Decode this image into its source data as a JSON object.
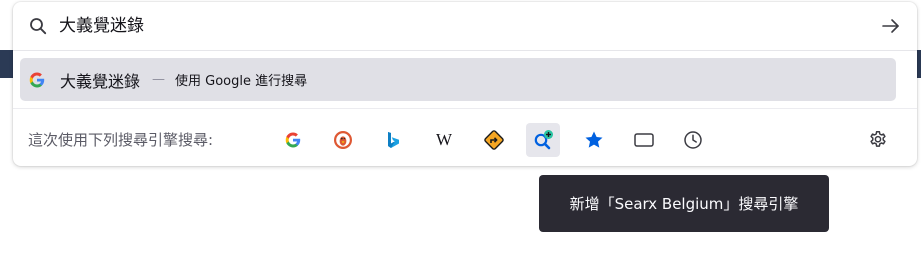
{
  "urlbar": {
    "value": "大義覺迷錄",
    "search_icon": "search-icon",
    "go_icon": "arrow-right-icon"
  },
  "result": {
    "engine_icon": "google-icon",
    "query": "大義覺迷錄",
    "separator": "—",
    "action": "使用 Google 進行搜尋"
  },
  "one_off": {
    "label": "這次使用下列搜尋引擎搜尋:",
    "engines": [
      {
        "name": "Google",
        "icon": "google-icon"
      },
      {
        "name": "DuckDuckGo",
        "icon": "duckduckgo-icon"
      },
      {
        "name": "Bing",
        "icon": "bing-icon"
      },
      {
        "name": "Wikipedia",
        "icon": "wikipedia-icon"
      },
      {
        "name": "Route",
        "icon": "road-sign-icon"
      },
      {
        "name": "Add Searx Belgium",
        "icon": "add-search-engine-icon",
        "selected": true
      },
      {
        "name": "Bookmarks",
        "icon": "star-icon"
      },
      {
        "name": "Tabs",
        "icon": "tab-icon"
      },
      {
        "name": "History",
        "icon": "clock-icon"
      }
    ],
    "settings_icon": "gear-icon"
  },
  "tooltip": {
    "text": "新增「Searx Belgium」搜尋引擎"
  },
  "colors": {
    "accent_blue": "#0061e0",
    "nav_band": "#2b3a55",
    "selected_row": "#e0e0e6",
    "tooltip_bg": "#2b2a33"
  }
}
